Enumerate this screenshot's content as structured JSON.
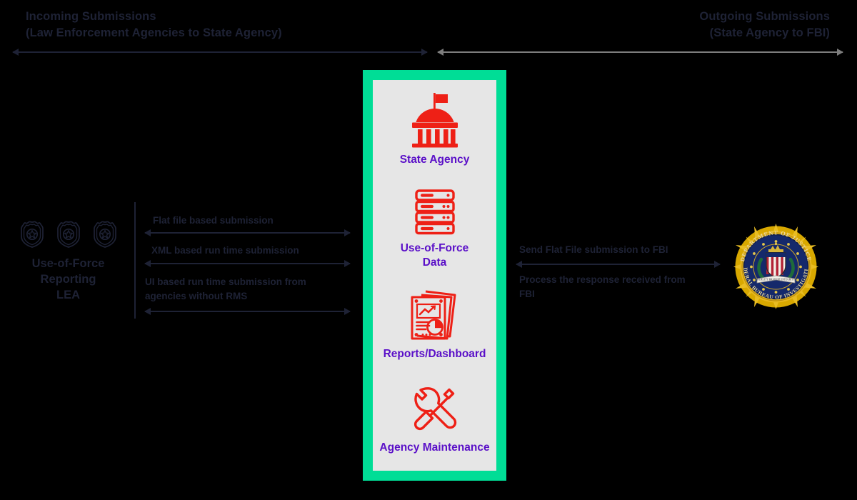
{
  "diagram": {
    "title_left": "Incoming Submissions",
    "subtitle_left": "(Law Enforcement Agencies to State Agency)",
    "title_right": "Outgoing Submissions",
    "subtitle_right": "(State Agency to FBI)"
  },
  "colors": {
    "background": "#000000",
    "navy": "#1e2235",
    "grey_arrow": "#7d7d7d",
    "card_border_green": "#00dd96",
    "card_fill_grey": "#e6e6e6",
    "icon_red": "#ee2016",
    "label_purple": "#5a0fc8",
    "fbi_gold": "#e8b81f",
    "fbi_navy": "#15296b"
  },
  "left_actor": {
    "icon": "police-badge-icon",
    "icon_count": 3,
    "label_lines": [
      "Use-of-Force",
      "Reporting",
      "LEA"
    ]
  },
  "incoming_flows": [
    {
      "label": "Flat file based submission",
      "direction": "bidirectional"
    },
    {
      "label": "XML based run time submission",
      "direction": "bidirectional"
    },
    {
      "label": "UI based run time submission from agencies without RMS",
      "direction": "bidirectional"
    }
  ],
  "outgoing_flows": [
    {
      "label": "Send Flat File submission to FBI",
      "direction": "bidirectional"
    },
    {
      "label": "Process the response received from FBI",
      "direction": "bidirectional"
    }
  ],
  "state_agency_card": {
    "items": [
      {
        "icon": "capitol-building-icon",
        "label": "State Agency"
      },
      {
        "icon": "server-stack-icon",
        "label": "Use-of-Force\nData",
        "label_lines": [
          "Use-of-Force",
          "Data"
        ]
      },
      {
        "icon": "reports-dashboard-icon",
        "label": "Reports/Dashboard"
      },
      {
        "icon": "wrench-screwdriver-icon",
        "label": "Agency Maintenance"
      }
    ]
  },
  "right_actor": {
    "icon": "fbi-seal-icon",
    "seal_text_top": "DEPARTMENT OF JUSTICE",
    "seal_text_bottom": "FEDERAL BUREAU OF INVESTIGATION",
    "seal_ribbon_text": "FIDELITY BRAVERY INTEGRITY"
  }
}
